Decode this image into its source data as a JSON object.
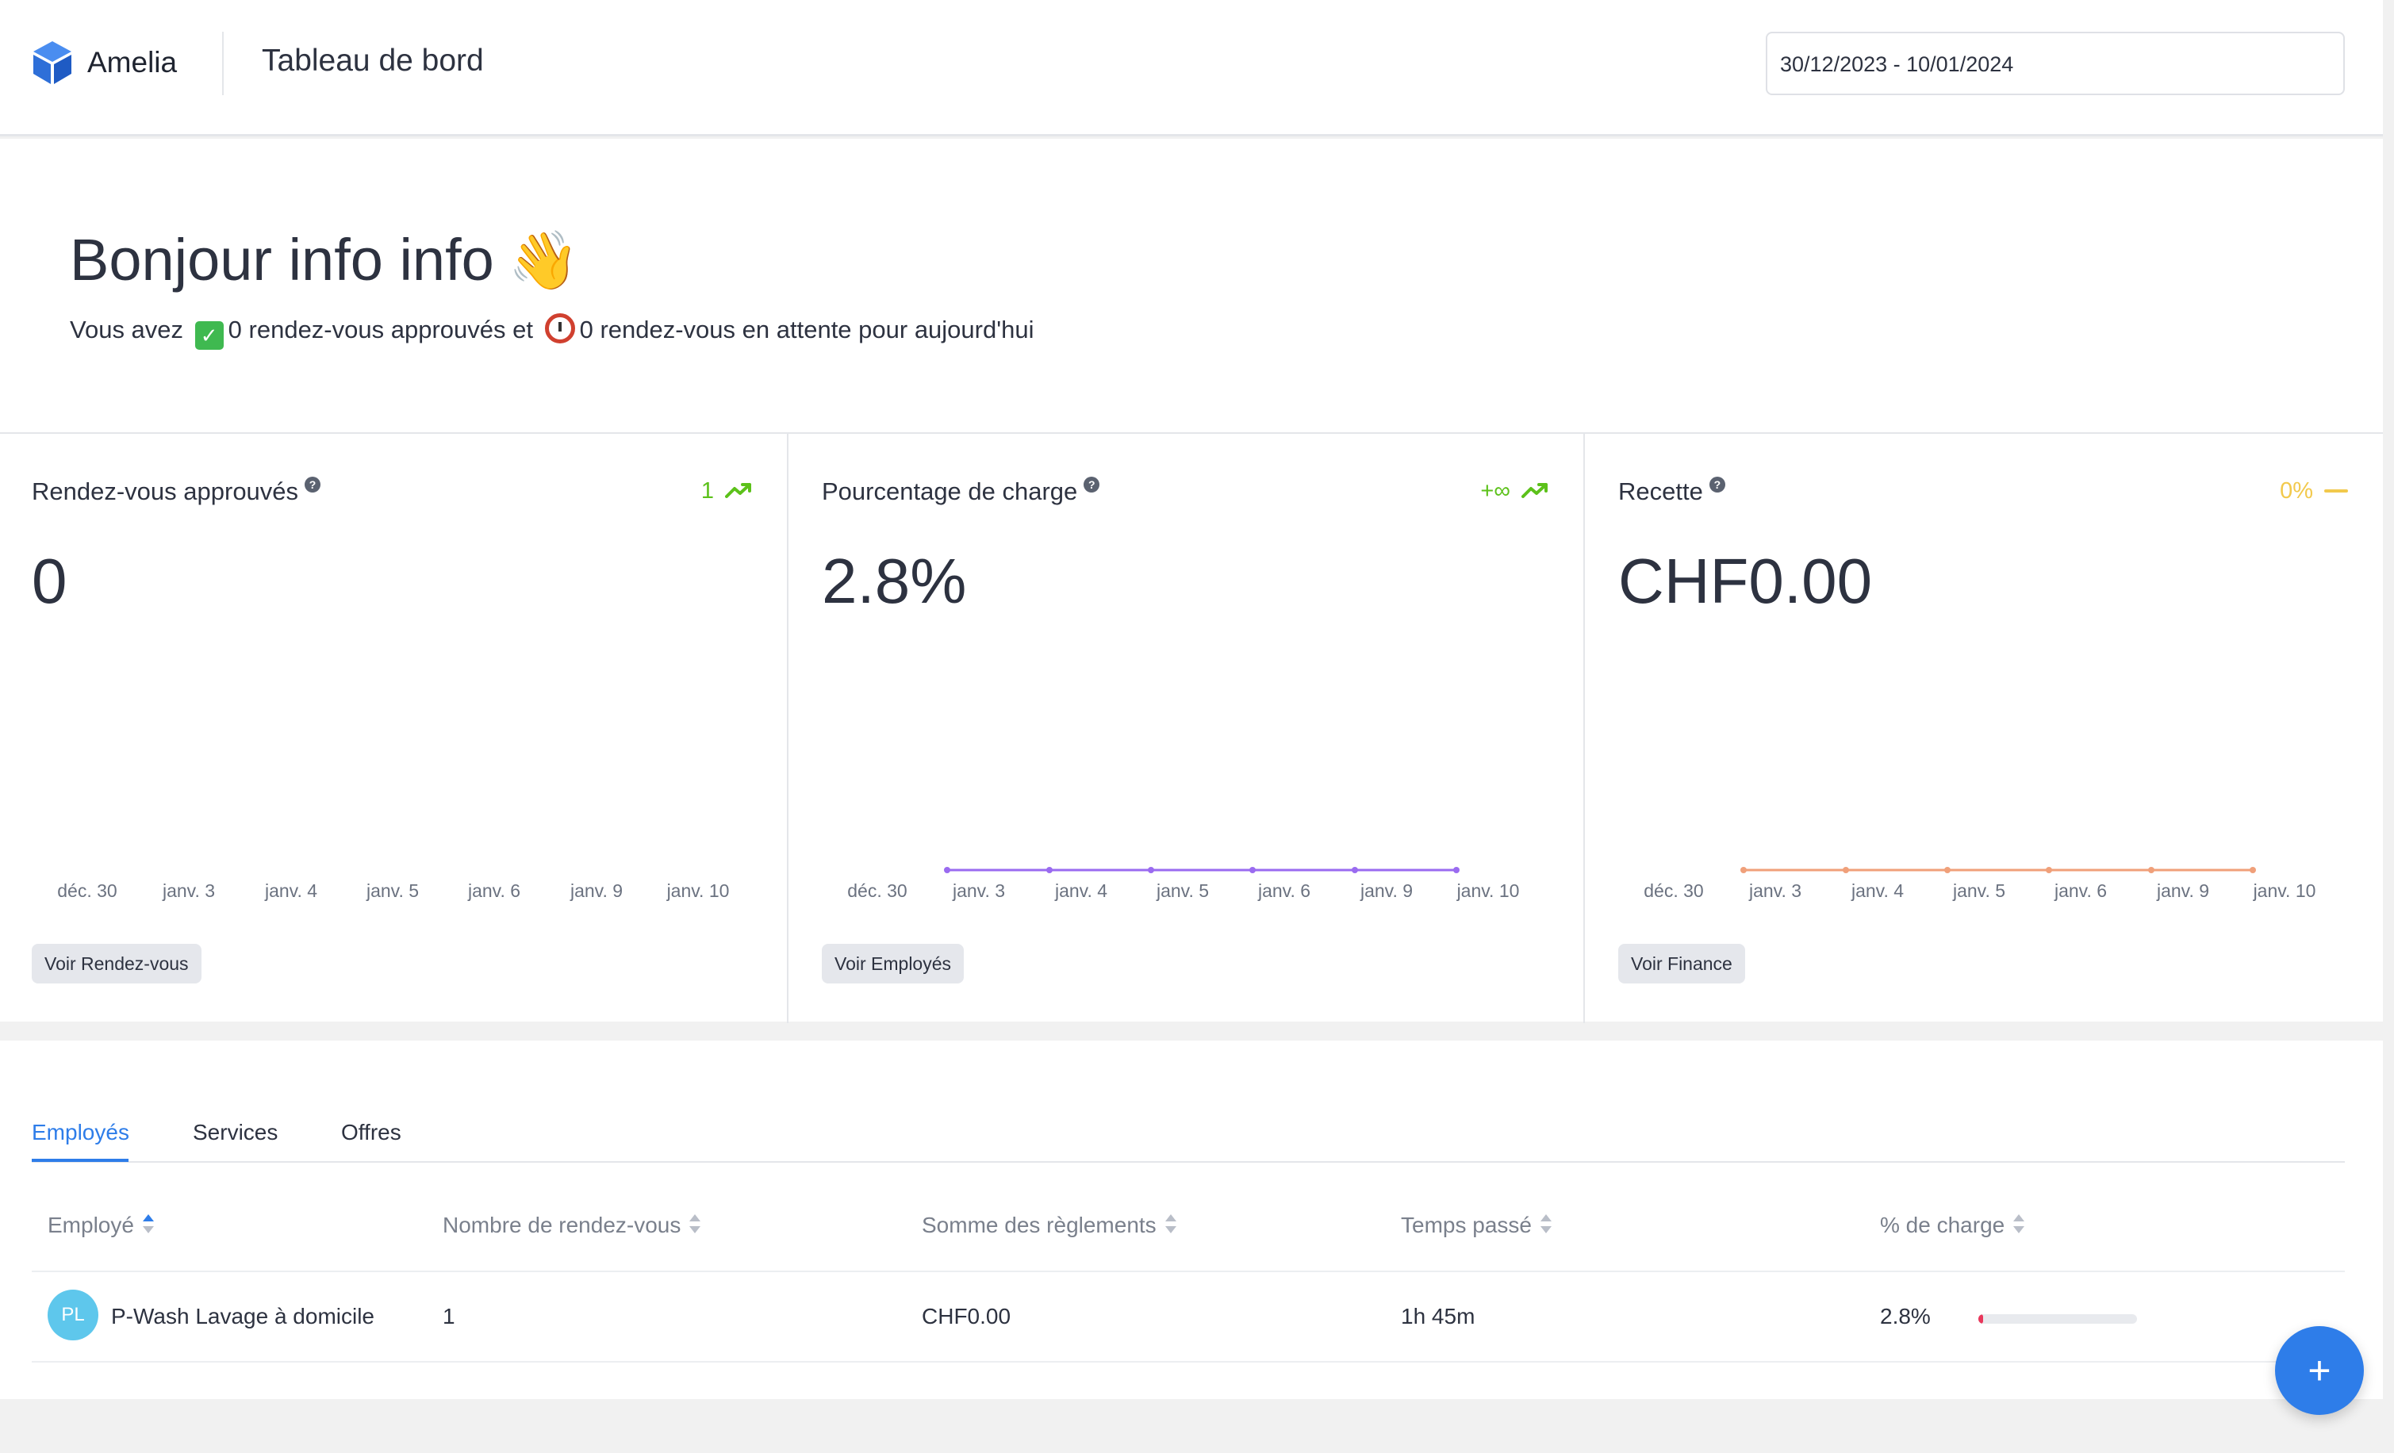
{
  "header": {
    "brand": "Amelia",
    "page_title": "Tableau de bord",
    "date_range": "30/12/2023 - 10/01/2024"
  },
  "greeting": {
    "title": "Bonjour info info",
    "wave_emoji": "👋",
    "sub_prefix": "Vous avez",
    "approved_text": "0 rendez-vous approuvés et",
    "pending_text": "0 rendez-vous en attente pour aujourd'hui"
  },
  "stats": [
    {
      "title": "Rendez-vous approuvés",
      "trend": "1",
      "trend_icon": "trending-up-icon",
      "trend_color": "#5cc11a",
      "value": "0",
      "button": "Voir Rendez-vous",
      "x_labels": [
        "déc. 30",
        "janv. 3",
        "janv. 4",
        "janv. 5",
        "janv. 6",
        "janv. 9",
        "janv. 10"
      ]
    },
    {
      "title": "Pourcentage de charge",
      "trend": "+∞",
      "trend_icon": "trending-up-icon",
      "trend_color": "#5cc11a",
      "value": "2.8%",
      "button": "Voir Employés",
      "line_color": "#9a6bf0",
      "x_labels": [
        "déc. 30",
        "janv. 3",
        "janv. 4",
        "janv. 5",
        "janv. 6",
        "janv. 9",
        "janv. 10"
      ]
    },
    {
      "title": "Recette",
      "trend": "0%",
      "trend_icon": "minus-icon",
      "trend_color": "#f2c94c",
      "value": "CHF0.00",
      "button": "Voir Finance",
      "line_color": "#f0a07a",
      "x_labels": [
        "déc. 30",
        "janv. 3",
        "janv. 4",
        "janv. 5",
        "janv. 6",
        "janv. 9",
        "janv. 10"
      ]
    }
  ],
  "tabs": [
    "Employés",
    "Services",
    "Offres"
  ],
  "table": {
    "columns": [
      "Employé",
      "Nombre de rendez-vous",
      "Somme des règlements",
      "Temps passé",
      "% de charge"
    ],
    "rows": [
      {
        "initials": "PL",
        "name": "P-Wash Lavage à domicile",
        "appointments": "1",
        "payments": "CHF0.00",
        "time": "1h 45m",
        "load": "2.8%",
        "load_fraction": 0.028
      }
    ]
  },
  "fab_label": "+"
}
